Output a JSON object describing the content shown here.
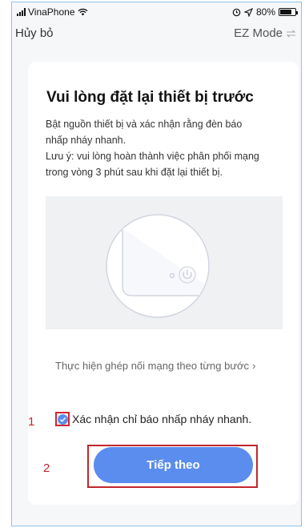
{
  "status_bar": {
    "carrier": "VinaPhone",
    "battery": "80%",
    "battery_level": 0.8
  },
  "nav": {
    "cancel": "Hủy bỏ",
    "mode": "EZ Mode"
  },
  "card": {
    "title": "Vui lòng đặt lại thiết bị trước",
    "desc_line1": "Bật nguồn thiết bị và xác nhận rằng đèn báo",
    "desc_line2": "nhấp nháy nhanh.",
    "desc_line3": "Lưu ý: vui lòng hoàn thành việc phân phối mạng",
    "desc_line4": "trong vòng 3 phút sau khi đặt lại thiết bị.",
    "step_link": "Thực hiện ghép nối mạng theo từng bước",
    "step_link_arrow": "›"
  },
  "confirm": {
    "label": "Xác nhận chỉ báo nhấp nháy nhanh.",
    "checked": true
  },
  "annotations": {
    "one": "1",
    "two": "2"
  },
  "next_button": {
    "label": "Tiếp theo"
  },
  "colors": {
    "accent": "#5b8def",
    "annotation": "#c0272d"
  }
}
